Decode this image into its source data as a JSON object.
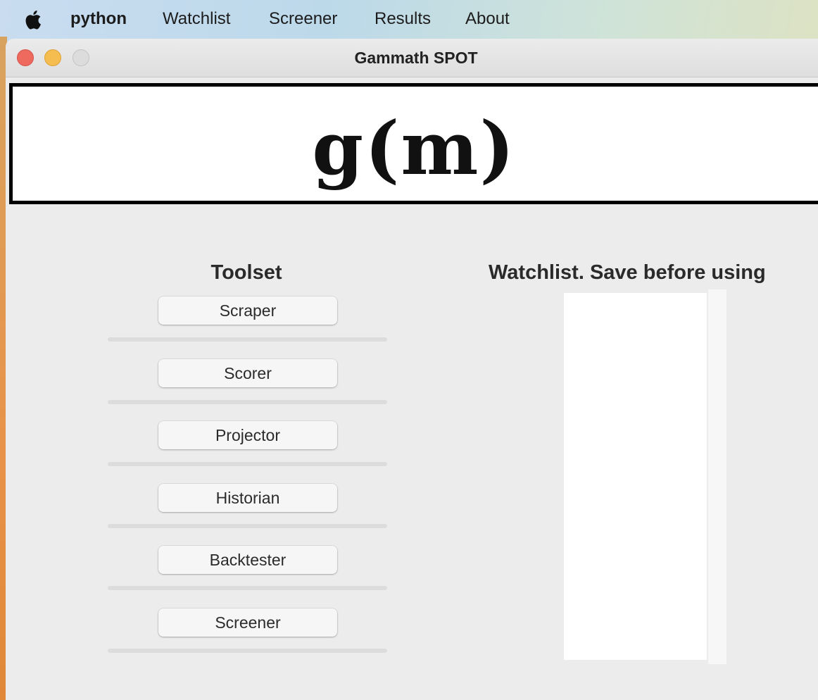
{
  "menubar": {
    "app_name": "python",
    "items": [
      "Watchlist",
      "Screener",
      "Results",
      "About"
    ]
  },
  "window": {
    "title": "Gammath SPOT"
  },
  "banner": {
    "logo_text": "g(m)"
  },
  "toolset": {
    "title": "Toolset",
    "buttons": [
      "Scraper",
      "Scorer",
      "Projector",
      "Historian",
      "Backtester",
      "Screener"
    ]
  },
  "watchlist": {
    "title": "Watchlist. Save before using",
    "items": []
  },
  "colors": {
    "close": "#ee6a5f",
    "minimize": "#f5bd4f",
    "zoom": "#dcdcdc",
    "window_bg": "#ececec"
  }
}
